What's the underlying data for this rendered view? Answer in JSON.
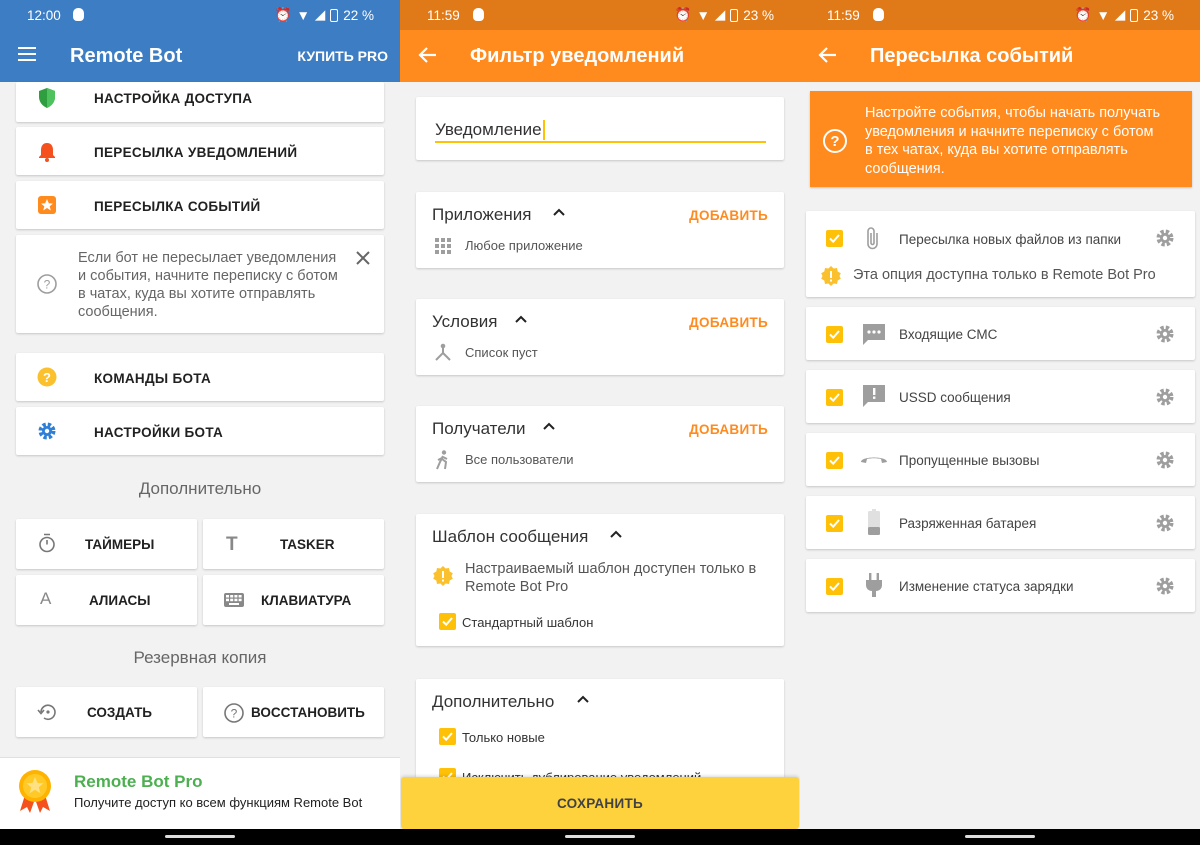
{
  "colors": {
    "blue": "#3d7dc4",
    "orange": "#ff8a1e",
    "yellow": "#ffc107",
    "green": "#4caf50"
  },
  "screen1": {
    "status": {
      "time": "12:00",
      "battery": "22 %"
    },
    "appbar": {
      "title": "Remote Bot",
      "buy_pro": "КУПИТЬ PRO"
    },
    "menu": [
      {
        "label": "НАСТРОЙКА ДОСТУПА",
        "icon": "shield-icon"
      },
      {
        "label": "ПЕРЕСЫЛКА УВЕДОМЛЕНИЙ",
        "icon": "bell-icon"
      },
      {
        "label": "ПЕРЕСЫЛКА СОБЫТИЙ",
        "icon": "event-star-icon"
      }
    ],
    "hint": {
      "text": "Если бот не пересылает уведомления и события, начните переписку с ботом в чатах, куда вы хотите отправлять сообщения."
    },
    "menu2": [
      {
        "label": "КОМАНДЫ БОТА",
        "icon": "help-circle-icon"
      },
      {
        "label": "НАСТРОЙКИ БОТА",
        "icon": "gear-icon"
      }
    ],
    "extra_title": "Дополнительно",
    "extra": [
      {
        "label": "ТАЙМЕРЫ",
        "icon": "timer-icon"
      },
      {
        "label": "TASKER",
        "icon": "text-t-icon"
      },
      {
        "label": "АЛИАСЫ",
        "icon": "letter-a-icon"
      },
      {
        "label": "КЛАВИАТУРА",
        "icon": "keyboard-icon"
      }
    ],
    "backup_title": "Резервная копия",
    "backup": [
      {
        "label": "СОЗДАТЬ",
        "icon": "backup-restore-icon"
      },
      {
        "label": "ВОССТАНОВИТЬ",
        "icon": "help-circle-outline-icon"
      }
    ],
    "promo": {
      "title": "Remote Bot Pro",
      "text": "Получите доступ ко всем функциям Remote Bot"
    }
  },
  "screen2": {
    "status": {
      "time": "11:59",
      "battery": "23 %"
    },
    "appbar": {
      "title": "Фильтр уведомлений"
    },
    "name_value": "Уведомление",
    "cards": [
      {
        "title": "Приложения",
        "add": "ДОБАВИТЬ",
        "sub": "Любое приложение"
      },
      {
        "title": "Условия",
        "add": "ДОБАВИТЬ",
        "sub": "Список пуст"
      },
      {
        "title": "Получатели",
        "add": "ДОБАВИТЬ",
        "sub": "Все пользователи"
      }
    ],
    "template": {
      "title": "Шаблон сообщения",
      "note": "Настраиваемый шаблон доступен только в Remote Bot Pro",
      "checkbox": "Стандартный шаблон"
    },
    "extra": {
      "title": "Дополнительно",
      "opt1": "Только новые",
      "opt2": "Исключить дублирование уведомлений"
    },
    "save": "СОХРАНИТЬ"
  },
  "screen3": {
    "status": {
      "time": "11:59",
      "battery": "23 %"
    },
    "appbar": {
      "title": "Пересылка событий"
    },
    "banner": "Настройте события, чтобы начать получать уведомления и начните переписку с ботом в тех чатах, куда вы хотите отправлять сообщения.",
    "folder": {
      "label": "Пересылка новых файлов из папки",
      "pro_note": "Эта опция доступна только в Remote Bot Pro"
    },
    "events": [
      {
        "label": "Входящие СМС",
        "icon": "sms-icon"
      },
      {
        "label": "USSD сообщения",
        "icon": "ussd-icon"
      },
      {
        "label": "Пропущенные вызовы",
        "icon": "missed-call-icon"
      },
      {
        "label": "Разряженная батарея",
        "icon": "battery-low-icon"
      },
      {
        "label": "Изменение статуса зарядки",
        "icon": "power-plug-icon"
      }
    ]
  }
}
